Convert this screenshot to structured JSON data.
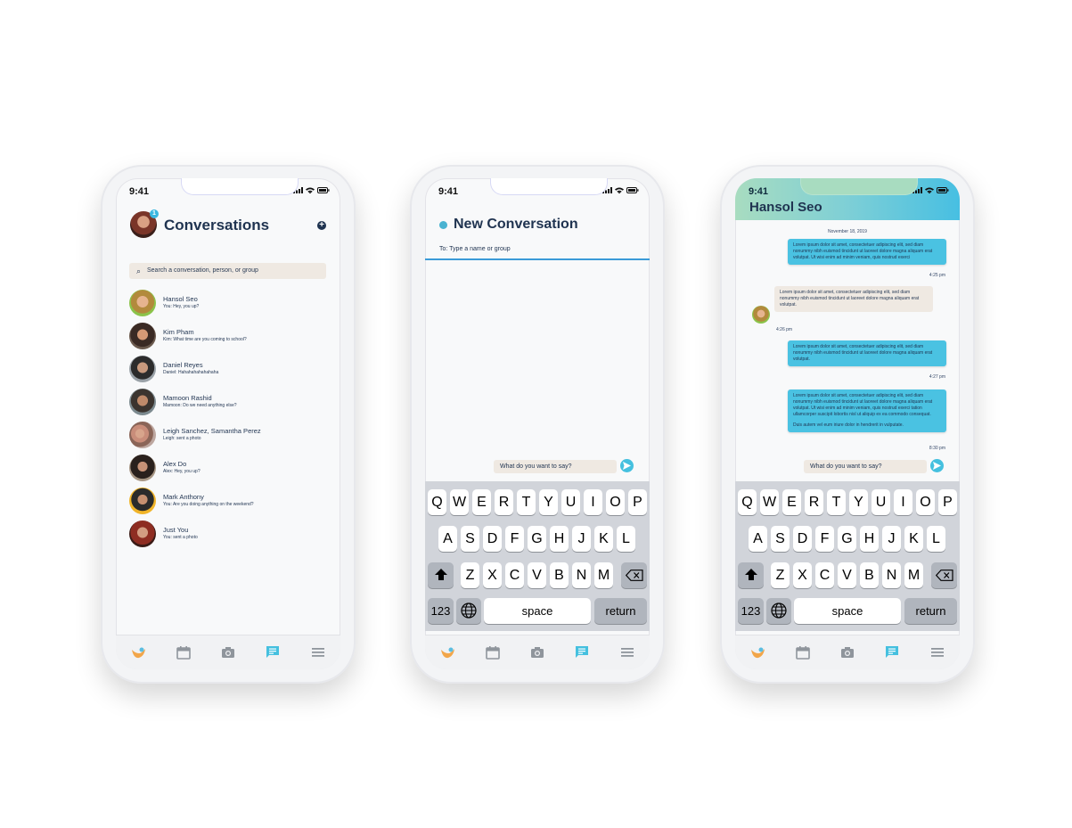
{
  "status": {
    "time": "9:41"
  },
  "tabbar": {
    "icons": [
      "bird-logo-icon",
      "calendar-icon",
      "camera-icon",
      "chat-icon",
      "menu-icon"
    ]
  },
  "conversations_screen": {
    "title": "Conversations",
    "badge_count": "1",
    "search_placeholder": "Search a conversation, person, or group",
    "contacts": [
      {
        "name": "Hansol Seo",
        "message": "You: Hey, you up?"
      },
      {
        "name": "Kim Pham",
        "message": "Kim: What time are you coming to school?"
      },
      {
        "name": "Daniel Reyes",
        "message": "Daniel: Hahahahahahahaha"
      },
      {
        "name": "Mamoon Rashid",
        "message": "Mamoon: Do we need anything else?"
      },
      {
        "name": "Leigh Sanchez, Samantha Perez",
        "message": "Leigh: sent a photo"
      },
      {
        "name": "Alex Do",
        "message": "Alex: Hey, you up?"
      },
      {
        "name": "Mark Anthony",
        "message": "You: Are you doing anything on the weekend?"
      },
      {
        "name": "Just You",
        "message": "You: sent a photo"
      }
    ]
  },
  "new_conversation_screen": {
    "title": "New Conversation",
    "to_placeholder": "To: Type a name or group",
    "compose_placeholder": "What do you want to say?"
  },
  "keyboard": {
    "row1": [
      "Q",
      "W",
      "E",
      "R",
      "T",
      "Y",
      "U",
      "I",
      "O",
      "P"
    ],
    "row2": [
      "A",
      "S",
      "D",
      "F",
      "G",
      "H",
      "J",
      "K",
      "L"
    ],
    "row3": [
      "Z",
      "X",
      "C",
      "V",
      "B",
      "N",
      "M"
    ],
    "numbers_label": "123",
    "space_label": "space",
    "return_label": "return"
  },
  "chat_screen": {
    "title": "Hansol Seo",
    "date": "November 18, 2019",
    "messages": [
      {
        "direction": "out",
        "text": "Lorem ipsum dolor sit amet, consectetuer adipiscing elit, sed diam nonummy nibh euismod tincidunt ut laoreet dolore magna aliquam erat volutpat. Ut wisi enim ad minim veniam, quis nostrud exerci",
        "time": "4:25 pm"
      },
      {
        "direction": "in",
        "text": "Lorem ipsum dolor sit amet, consectetuer adipiscing elit, sed diam nonummy nibh euismod tincidunt ut laoreet dolore magna aliquam erat volutpat.",
        "time": "4:26 pm"
      },
      {
        "direction": "out",
        "text": "Lorem ipsum dolor sit amet, consectetuer adipiscing elit, sed diam nonummy nibh euismod tincidunt ut laoreet dolore magna aliquam erat volutpat.",
        "time": "4:27 pm"
      },
      {
        "direction": "out",
        "text": "Lorem ipsum dolor sit amet, consectetuer adipiscing elit, sed diam nonummy nibh euismod tincidunt ut laoreet dolore magna aliquam erat volutpat. Ut wisi enim ad minim veniam, quis nostrud exerci tation ullamcorper suscipit lobortis nisl ut aliquip ex ea commodo consequat.",
        "text2": "Duis autem vel eum iriure dolor in hendrerit in vulputate.",
        "time": "8:30 pm"
      }
    ],
    "compose_placeholder": "What do you want to say?"
  },
  "colors": {
    "accent": "#45c0df",
    "navy": "#1f3350",
    "input_bg": "#efe9e2"
  }
}
